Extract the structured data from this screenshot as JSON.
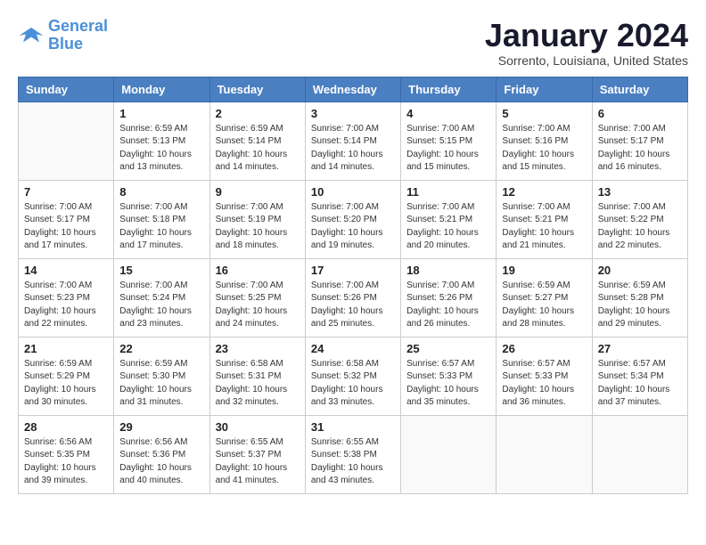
{
  "logo": {
    "line1": "General",
    "line2": "Blue"
  },
  "title": "January 2024",
  "location": "Sorrento, Louisiana, United States",
  "days_header": [
    "Sunday",
    "Monday",
    "Tuesday",
    "Wednesday",
    "Thursday",
    "Friday",
    "Saturday"
  ],
  "weeks": [
    [
      {
        "day": "",
        "sunrise": "",
        "sunset": "",
        "daylight": ""
      },
      {
        "day": "1",
        "sunrise": "Sunrise: 6:59 AM",
        "sunset": "Sunset: 5:13 PM",
        "daylight": "Daylight: 10 hours and 13 minutes."
      },
      {
        "day": "2",
        "sunrise": "Sunrise: 6:59 AM",
        "sunset": "Sunset: 5:14 PM",
        "daylight": "Daylight: 10 hours and 14 minutes."
      },
      {
        "day": "3",
        "sunrise": "Sunrise: 7:00 AM",
        "sunset": "Sunset: 5:14 PM",
        "daylight": "Daylight: 10 hours and 14 minutes."
      },
      {
        "day": "4",
        "sunrise": "Sunrise: 7:00 AM",
        "sunset": "Sunset: 5:15 PM",
        "daylight": "Daylight: 10 hours and 15 minutes."
      },
      {
        "day": "5",
        "sunrise": "Sunrise: 7:00 AM",
        "sunset": "Sunset: 5:16 PM",
        "daylight": "Daylight: 10 hours and 15 minutes."
      },
      {
        "day": "6",
        "sunrise": "Sunrise: 7:00 AM",
        "sunset": "Sunset: 5:17 PM",
        "daylight": "Daylight: 10 hours and 16 minutes."
      }
    ],
    [
      {
        "day": "7",
        "sunrise": "Sunrise: 7:00 AM",
        "sunset": "Sunset: 5:17 PM",
        "daylight": "Daylight: 10 hours and 17 minutes."
      },
      {
        "day": "8",
        "sunrise": "Sunrise: 7:00 AM",
        "sunset": "Sunset: 5:18 PM",
        "daylight": "Daylight: 10 hours and 17 minutes."
      },
      {
        "day": "9",
        "sunrise": "Sunrise: 7:00 AM",
        "sunset": "Sunset: 5:19 PM",
        "daylight": "Daylight: 10 hours and 18 minutes."
      },
      {
        "day": "10",
        "sunrise": "Sunrise: 7:00 AM",
        "sunset": "Sunset: 5:20 PM",
        "daylight": "Daylight: 10 hours and 19 minutes."
      },
      {
        "day": "11",
        "sunrise": "Sunrise: 7:00 AM",
        "sunset": "Sunset: 5:21 PM",
        "daylight": "Daylight: 10 hours and 20 minutes."
      },
      {
        "day": "12",
        "sunrise": "Sunrise: 7:00 AM",
        "sunset": "Sunset: 5:21 PM",
        "daylight": "Daylight: 10 hours and 21 minutes."
      },
      {
        "day": "13",
        "sunrise": "Sunrise: 7:00 AM",
        "sunset": "Sunset: 5:22 PM",
        "daylight": "Daylight: 10 hours and 22 minutes."
      }
    ],
    [
      {
        "day": "14",
        "sunrise": "Sunrise: 7:00 AM",
        "sunset": "Sunset: 5:23 PM",
        "daylight": "Daylight: 10 hours and 22 minutes."
      },
      {
        "day": "15",
        "sunrise": "Sunrise: 7:00 AM",
        "sunset": "Sunset: 5:24 PM",
        "daylight": "Daylight: 10 hours and 23 minutes."
      },
      {
        "day": "16",
        "sunrise": "Sunrise: 7:00 AM",
        "sunset": "Sunset: 5:25 PM",
        "daylight": "Daylight: 10 hours and 24 minutes."
      },
      {
        "day": "17",
        "sunrise": "Sunrise: 7:00 AM",
        "sunset": "Sunset: 5:26 PM",
        "daylight": "Daylight: 10 hours and 25 minutes."
      },
      {
        "day": "18",
        "sunrise": "Sunrise: 7:00 AM",
        "sunset": "Sunset: 5:26 PM",
        "daylight": "Daylight: 10 hours and 26 minutes."
      },
      {
        "day": "19",
        "sunrise": "Sunrise: 6:59 AM",
        "sunset": "Sunset: 5:27 PM",
        "daylight": "Daylight: 10 hours and 28 minutes."
      },
      {
        "day": "20",
        "sunrise": "Sunrise: 6:59 AM",
        "sunset": "Sunset: 5:28 PM",
        "daylight": "Daylight: 10 hours and 29 minutes."
      }
    ],
    [
      {
        "day": "21",
        "sunrise": "Sunrise: 6:59 AM",
        "sunset": "Sunset: 5:29 PM",
        "daylight": "Daylight: 10 hours and 30 minutes."
      },
      {
        "day": "22",
        "sunrise": "Sunrise: 6:59 AM",
        "sunset": "Sunset: 5:30 PM",
        "daylight": "Daylight: 10 hours and 31 minutes."
      },
      {
        "day": "23",
        "sunrise": "Sunrise: 6:58 AM",
        "sunset": "Sunset: 5:31 PM",
        "daylight": "Daylight: 10 hours and 32 minutes."
      },
      {
        "day": "24",
        "sunrise": "Sunrise: 6:58 AM",
        "sunset": "Sunset: 5:32 PM",
        "daylight": "Daylight: 10 hours and 33 minutes."
      },
      {
        "day": "25",
        "sunrise": "Sunrise: 6:57 AM",
        "sunset": "Sunset: 5:33 PM",
        "daylight": "Daylight: 10 hours and 35 minutes."
      },
      {
        "day": "26",
        "sunrise": "Sunrise: 6:57 AM",
        "sunset": "Sunset: 5:33 PM",
        "daylight": "Daylight: 10 hours and 36 minutes."
      },
      {
        "day": "27",
        "sunrise": "Sunrise: 6:57 AM",
        "sunset": "Sunset: 5:34 PM",
        "daylight": "Daylight: 10 hours and 37 minutes."
      }
    ],
    [
      {
        "day": "28",
        "sunrise": "Sunrise: 6:56 AM",
        "sunset": "Sunset: 5:35 PM",
        "daylight": "Daylight: 10 hours and 39 minutes."
      },
      {
        "day": "29",
        "sunrise": "Sunrise: 6:56 AM",
        "sunset": "Sunset: 5:36 PM",
        "daylight": "Daylight: 10 hours and 40 minutes."
      },
      {
        "day": "30",
        "sunrise": "Sunrise: 6:55 AM",
        "sunset": "Sunset: 5:37 PM",
        "daylight": "Daylight: 10 hours and 41 minutes."
      },
      {
        "day": "31",
        "sunrise": "Sunrise: 6:55 AM",
        "sunset": "Sunset: 5:38 PM",
        "daylight": "Daylight: 10 hours and 43 minutes."
      },
      {
        "day": "",
        "sunrise": "",
        "sunset": "",
        "daylight": ""
      },
      {
        "day": "",
        "sunrise": "",
        "sunset": "",
        "daylight": ""
      },
      {
        "day": "",
        "sunrise": "",
        "sunset": "",
        "daylight": ""
      }
    ]
  ]
}
